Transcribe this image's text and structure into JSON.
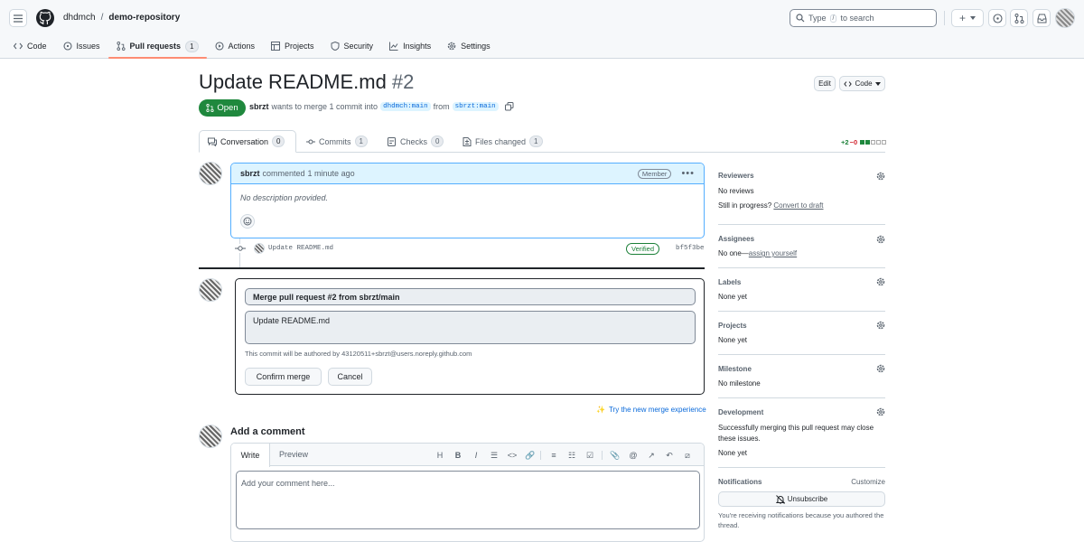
{
  "header": {
    "owner": "dhdmch",
    "separator": "/",
    "repo": "demo-repository",
    "search_prefix": "Type",
    "search_key": "/",
    "search_suffix": "to search",
    "plus_label": "+"
  },
  "repo_tabs": [
    {
      "label": "Code",
      "icon": "code-icon"
    },
    {
      "label": "Issues",
      "icon": "issue-icon"
    },
    {
      "label": "Pull requests",
      "icon": "pull-request-icon",
      "count": "1",
      "selected": true
    },
    {
      "label": "Actions",
      "icon": "play-icon"
    },
    {
      "label": "Projects",
      "icon": "table-icon"
    },
    {
      "label": "Security",
      "icon": "shield-icon"
    },
    {
      "label": "Insights",
      "icon": "graph-icon"
    },
    {
      "label": "Settings",
      "icon": "gear-icon"
    }
  ],
  "pr": {
    "title": "Update README.md",
    "number": "#2",
    "state": "Open",
    "author": "sbrzt",
    "merge_text": "wants to merge 1 commit into",
    "base_branch": "dhdmch:main",
    "from_text": "from",
    "head_branch": "sbrzt:main",
    "edit_label": "Edit",
    "code_label": "Code"
  },
  "pr_tabs": [
    {
      "label": "Conversation",
      "count": "0",
      "icon": "comment-icon"
    },
    {
      "label": "Commits",
      "count": "1",
      "icon": "commit-icon"
    },
    {
      "label": "Checks",
      "count": "0",
      "icon": "checklist-icon"
    },
    {
      "label": "Files changed",
      "count": "1",
      "icon": "file-diff-icon"
    }
  ],
  "diffstat": {
    "additions": "+2",
    "deletions": "−0",
    "squares": [
      "green",
      "green",
      "gray",
      "gray",
      "gray"
    ]
  },
  "comment": {
    "author": "sbrzt",
    "action": "commented",
    "time": "1 minute ago",
    "badge": "Member",
    "body": "No description provided."
  },
  "commit": {
    "message": "Update README.md",
    "verified": "Verified",
    "sha": "bf5f3be"
  },
  "merge": {
    "title_value": "Merge pull request #2 from sbrzt/main",
    "body_value": "Update README.md",
    "author_note": "This commit will be authored by 43120511+sbrzt@users.noreply.github.com",
    "confirm_label": "Confirm merge",
    "cancel_label": "Cancel",
    "new_experience": "Try the new merge experience"
  },
  "add_comment": {
    "heading": "Add a comment",
    "write_tab": "Write",
    "preview_tab": "Preview",
    "placeholder": "Add your comment here...",
    "toolbar": [
      "H",
      "B",
      "I",
      "quote",
      "code",
      "link",
      "ol",
      "ul",
      "task",
      "attach",
      "mention",
      "ref",
      "undo",
      "slash"
    ]
  },
  "sidebar": {
    "reviewers": {
      "title": "Reviewers",
      "value": "No reviews",
      "draft_prefix": "Still in progress?",
      "draft_link": "Convert to draft"
    },
    "assignees": {
      "title": "Assignees",
      "value_prefix": "No one—",
      "value_link": "assign yourself"
    },
    "labels": {
      "title": "Labels",
      "value": "None yet"
    },
    "projects": {
      "title": "Projects",
      "value": "None yet"
    },
    "milestone": {
      "title": "Milestone",
      "value": "No milestone"
    },
    "development": {
      "title": "Development",
      "description": "Successfully merging this pull request may close these issues.",
      "value": "None yet"
    },
    "notifications": {
      "title": "Notifications",
      "customize": "Customize",
      "button": "Unsubscribe",
      "note": "You're receiving notifications because you authored the thread."
    }
  },
  "colors": {
    "open_green": "#1f883d",
    "link_blue": "#0969da",
    "tab_underline": "#fd8c73",
    "border": "#d1d9e0"
  }
}
